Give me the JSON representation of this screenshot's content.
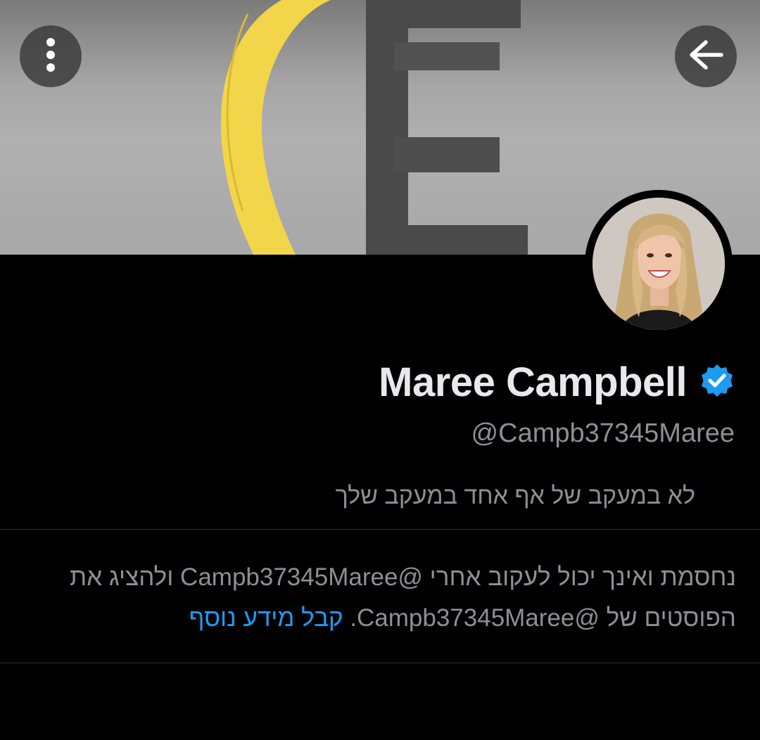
{
  "header": {
    "more_icon": "more-vertical-icon",
    "back_icon": "arrow-left-icon"
  },
  "profile": {
    "display_name": "Maree Campbell",
    "verified_icon": "verified-badge-icon",
    "handle": "@Campb37345Maree",
    "follow_status": "לא במעקב של אף אחד במעקב שלך"
  },
  "blocked_notice": {
    "part1": "נחסמת ואינך יכול לעקוב אחרי @Campb37345Maree ולהציג את הפוסטים של @Campb37345Maree.",
    "link": "קבל מידע נוסף"
  },
  "colors": {
    "background": "#000000",
    "accent_blue": "#1d9bf0",
    "secondary_text": "#8b9096",
    "verified_badge": "#1d9bf0",
    "banner_yellow": "#f3d54a"
  }
}
